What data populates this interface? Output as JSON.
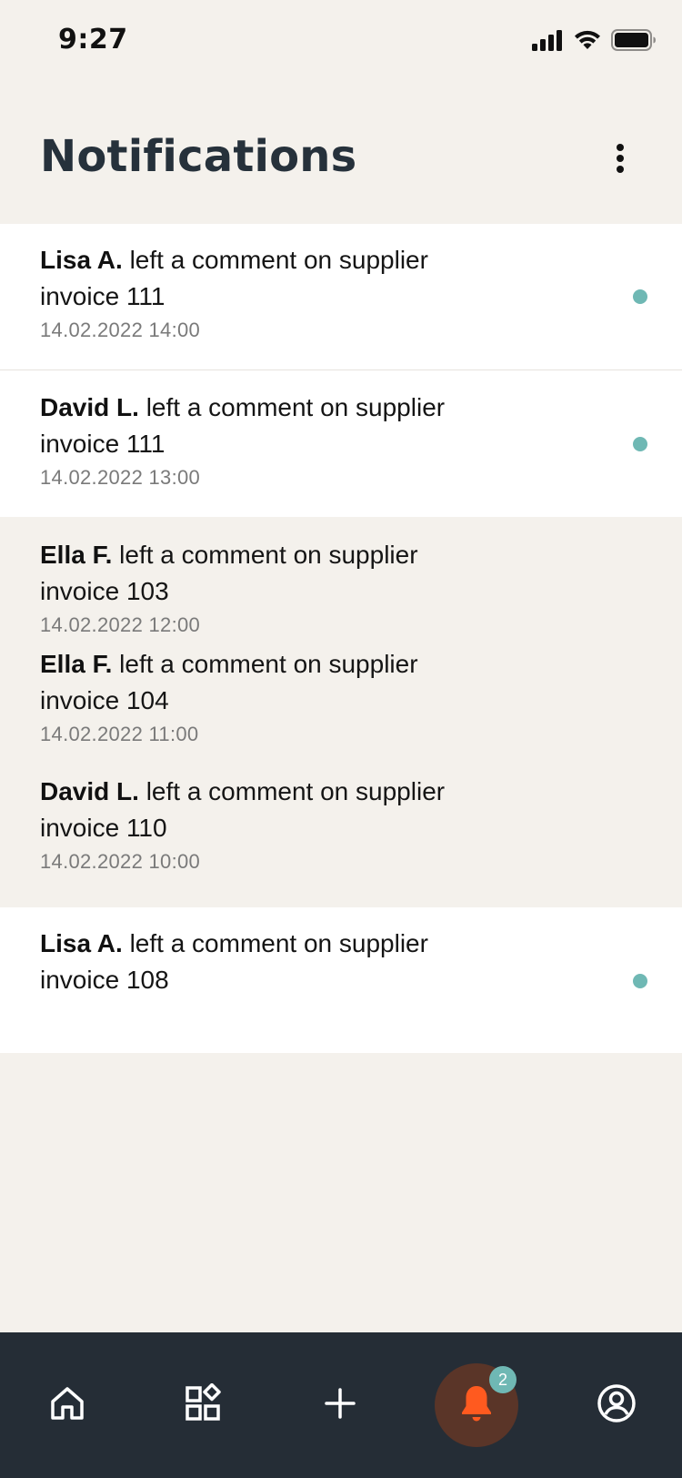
{
  "status_bar": {
    "time": "9:27",
    "icons": [
      "signal-icon",
      "wifi-icon",
      "battery-icon"
    ]
  },
  "header": {
    "title": "Notifications",
    "menu_icon": "more-vertical-icon"
  },
  "notifications": [
    {
      "author": "Lisa A.",
      "message": "left a comment on supplier invoice 111",
      "time": "14.02.2022 14:00",
      "unread": true
    },
    {
      "author": "David L.",
      "message": "left a comment on supplier invoice 111",
      "time": "14.02.2022 13:00",
      "unread": true
    },
    {
      "author": "Ella F.",
      "message": "left a comment on supplier invoice 103",
      "time": "14.02.2022 12:00",
      "unread": false
    },
    {
      "author": "Ella F.",
      "message": "left a comment on supplier invoice 104",
      "time": "14.02.2022 11:00",
      "unread": false
    },
    {
      "author": "David L.",
      "message": "left a comment on supplier invoice 110",
      "time": "14.02.2022 10:00",
      "unread": false
    },
    {
      "author": "Lisa A.",
      "message": "left a comment on supplier invoice 108",
      "time": "",
      "unread": true
    }
  ],
  "bottom_nav": {
    "items": [
      {
        "icon": "home-icon",
        "active": false
      },
      {
        "icon": "apps-icon",
        "active": false
      },
      {
        "icon": "plus-icon",
        "active": false
      },
      {
        "icon": "bell-icon",
        "active": true,
        "badge": "2"
      },
      {
        "icon": "account-icon",
        "active": false
      }
    ]
  },
  "colors": {
    "background": "#f4f1ec",
    "unread_background": "#ffffff",
    "unread_dot": "#6fb8b4",
    "title": "#26313b",
    "nav_background": "#252d36",
    "active_circle": "#5a3528",
    "active_icon": "#ff5a1f",
    "badge": "#6fb8b4"
  }
}
